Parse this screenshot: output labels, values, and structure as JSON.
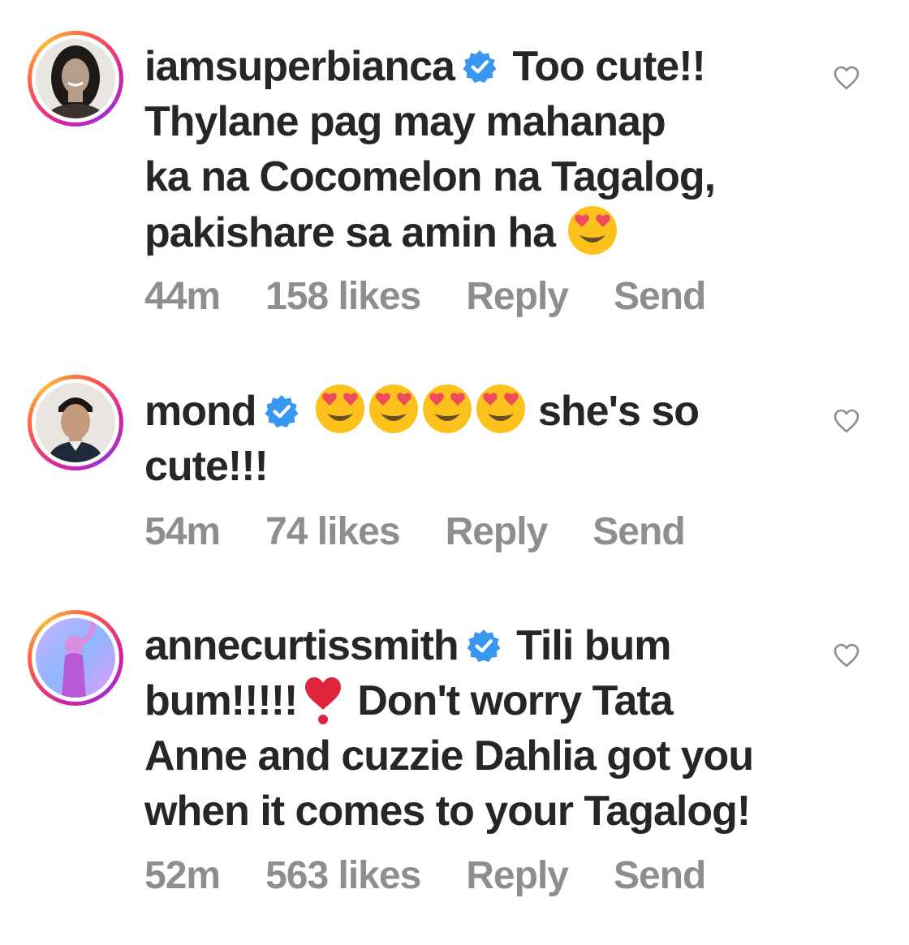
{
  "comments": [
    {
      "username": "iamsuperbianca",
      "lines": [
        "Too cute!!",
        "Thylane pag may mahanap",
        "ka na Cocomelon na Tagalog,",
        "pakishare sa amin ha"
      ],
      "time": "44m",
      "likes": "158 likes",
      "reply": "Reply",
      "send": "Send"
    },
    {
      "username": "mond",
      "lines": [
        "she's so",
        "cute!!!"
      ],
      "time": "54m",
      "likes": "74 likes",
      "reply": "Reply",
      "send": "Send"
    },
    {
      "username": "annecurtissmith",
      "lines": [
        "Tili bum",
        "bum!!!!!",
        "Don't worry Tata",
        "Anne and cuzzie Dahlia got you",
        "when it comes to your Tagalog!"
      ],
      "time": "52m",
      "likes": "563 likes",
      "reply": "Reply",
      "send": "Send"
    }
  ],
  "icons": {
    "verified": "verified-badge-icon",
    "like": "heart-outline-icon",
    "emoji_heart_eyes": "heart-eyes-emoji",
    "emoji_red_heart": "heart-exclamation-emoji"
  },
  "colors": {
    "text": "#262626",
    "meta": "#8e8e8e",
    "verified": "#3897f0"
  }
}
